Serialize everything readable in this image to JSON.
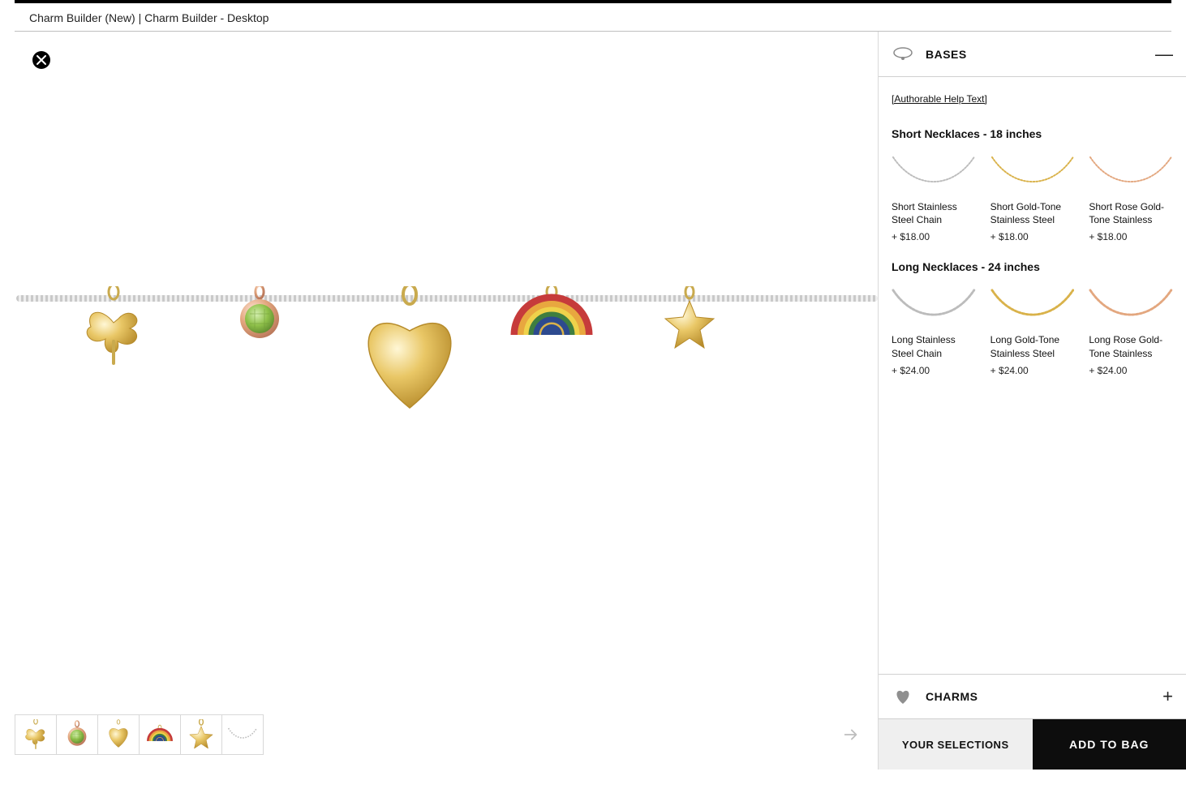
{
  "breadcrumb": {
    "part1": "Charm Builder (New)",
    "sep": " | ",
    "part2": "Charm Builder - Desktop"
  },
  "accordion": {
    "bases_title": "BASES",
    "charms_title": "CHARMS",
    "minus": "—",
    "plus": "+"
  },
  "help_text": "[Authorable Help Text]",
  "sections": {
    "short_title": "Short Necklaces - 18 inches",
    "long_title": "Long Necklaces - 24 inches"
  },
  "bases_short": [
    {
      "name": "Short Stainless Steel Chain",
      "price": "+ $18.00",
      "color": "#bcbcbc"
    },
    {
      "name": "Short Gold-Tone Stainless Steel",
      "price": "+ $18.00",
      "color": "#d9b24a"
    },
    {
      "name": "Short Rose Gold-Tone Stainless",
      "price": "+ $18.00",
      "color": "#e3a77f"
    }
  ],
  "bases_long": [
    {
      "name": "Long Stainless Steel Chain",
      "price": "+ $24.00",
      "color": "#bcbcbc"
    },
    {
      "name": "Long Gold-Tone Stainless Steel",
      "price": "+ $24.00",
      "color": "#d9b24a"
    },
    {
      "name": "Long Rose Gold-Tone Stainless",
      "price": "+ $24.00",
      "color": "#e3a77f"
    }
  ],
  "bottom": {
    "selections": "YOUR SELECTIONS",
    "add_to_bag": "ADD TO BAG"
  },
  "charm_names": {
    "clover": "clover-charm",
    "gem": "peridot-gem-charm",
    "heart": "gold-heart-charm",
    "rainbow": "rainbow-charm",
    "star": "gold-star-charm",
    "chain": "chain-base"
  }
}
